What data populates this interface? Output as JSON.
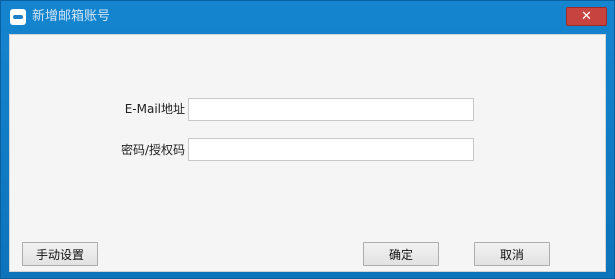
{
  "window": {
    "title": "新增邮箱账号",
    "close_symbol": "✕"
  },
  "form": {
    "email_label": "E-Mail地址",
    "email_value": "",
    "password_label": "密码/授权码",
    "password_value": ""
  },
  "buttons": {
    "manual_settings": "手动设置",
    "ok": "确定",
    "cancel": "取消"
  },
  "colors": {
    "titlebar": "#0d73bb",
    "close_button": "#c7433f",
    "client_background": "#f5f5f5"
  },
  "icons": {
    "app": "mail-app-icon",
    "close": "close-icon"
  }
}
